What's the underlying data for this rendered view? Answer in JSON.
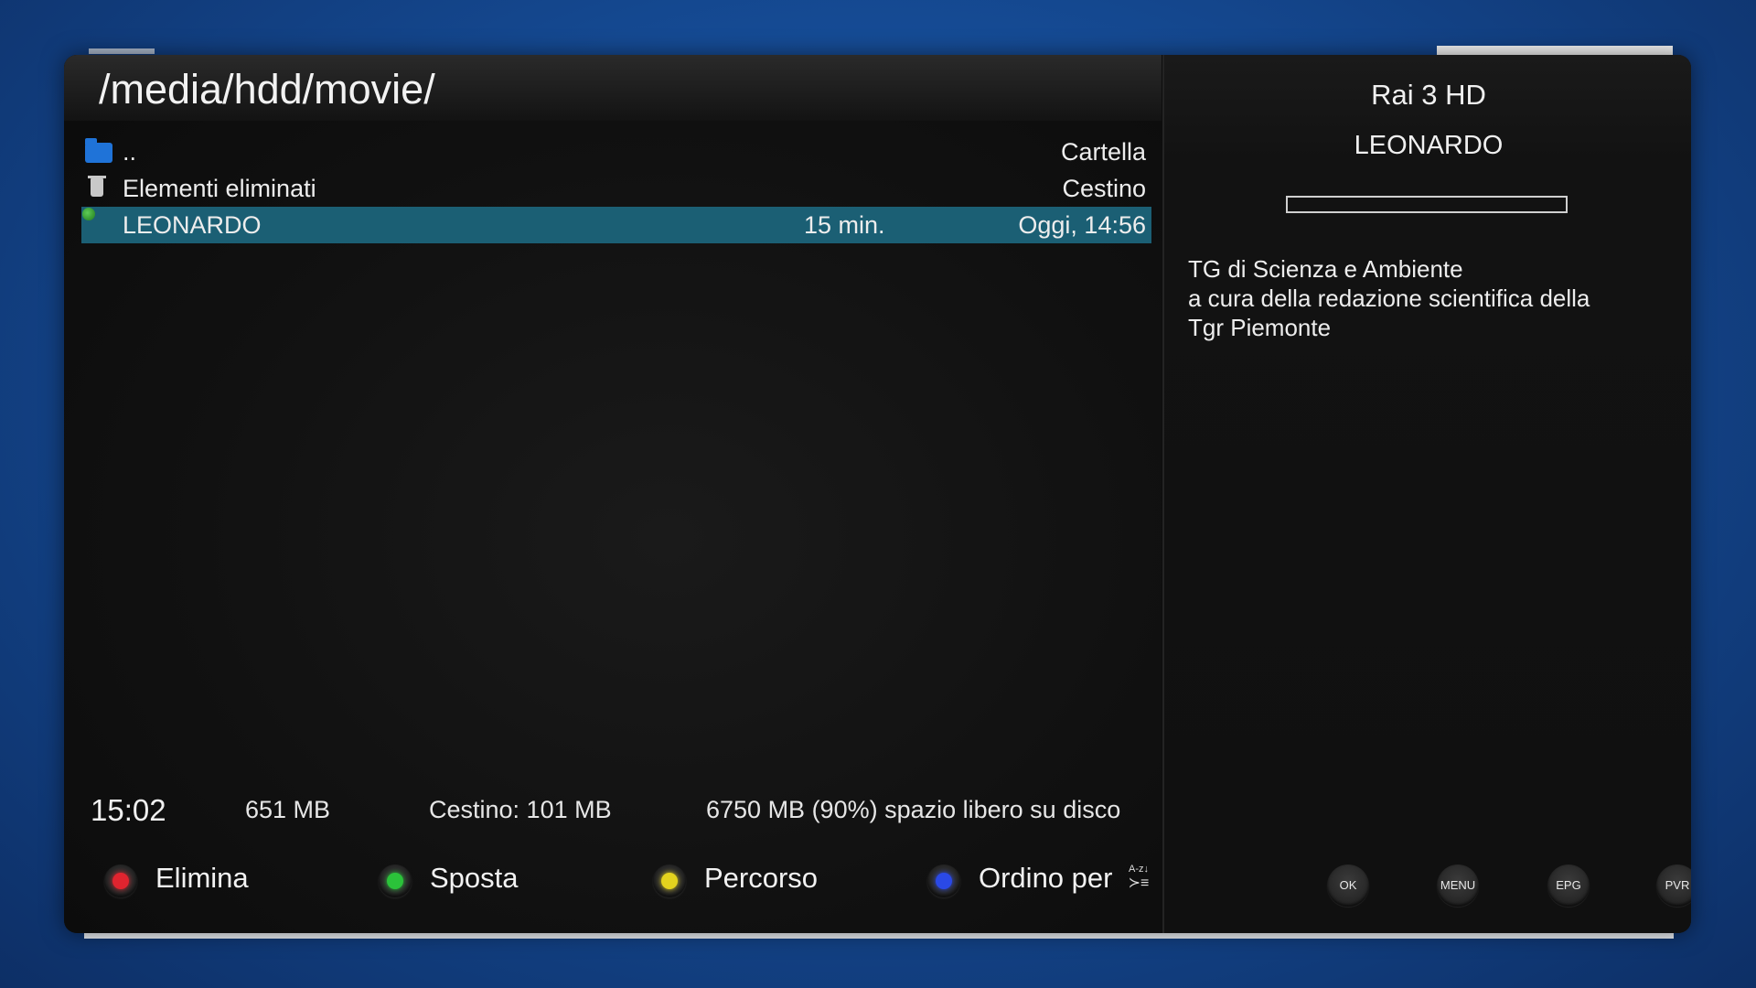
{
  "window": {
    "path_title": "/media/hdd/movie/"
  },
  "file_list": [
    {
      "icon": "folder-icon",
      "name": "..",
      "duration": "",
      "info": "Cartella"
    },
    {
      "icon": "trash-icon",
      "name": "Elementi eliminati",
      "duration": "",
      "info": "Cestino"
    },
    {
      "icon": "recording-dot-icon",
      "name": "LEONARDO",
      "duration": "15 min.",
      "info": "Oggi, 14:56",
      "selected": true
    }
  ],
  "status": {
    "clock": "15:02",
    "size": "651 MB",
    "trash": "Cestino: 101 MB",
    "free_space": "6750 MB (90%) spazio libero su disco"
  },
  "color_buttons": [
    {
      "color": "#e0242f",
      "label": "Elimina"
    },
    {
      "color": "#2bc23a",
      "label": "Sposta"
    },
    {
      "color": "#e3d21e",
      "label": "Percorso"
    },
    {
      "color": "#2a49e6",
      "label": "Ordino per"
    }
  ],
  "sort_icon": {
    "name": "sort-az-icon",
    "top_text": "A-z↓",
    "bars": "≻≡"
  },
  "info_panel": {
    "channel": "Rai 3 HD",
    "event": "LEONARDO",
    "progress": 0,
    "description_lines": [
      "TG di Scienza e Ambiente",
      "a cura della redazione scientifica della",
      "Tgr Piemonte"
    ]
  },
  "remote_buttons": [
    "OK",
    "MENU",
    "EPG",
    "PVR"
  ],
  "colors": {
    "selection": "#1b5f74",
    "panel_bg": "#0d0d0d",
    "background_blue": "#154a93"
  }
}
